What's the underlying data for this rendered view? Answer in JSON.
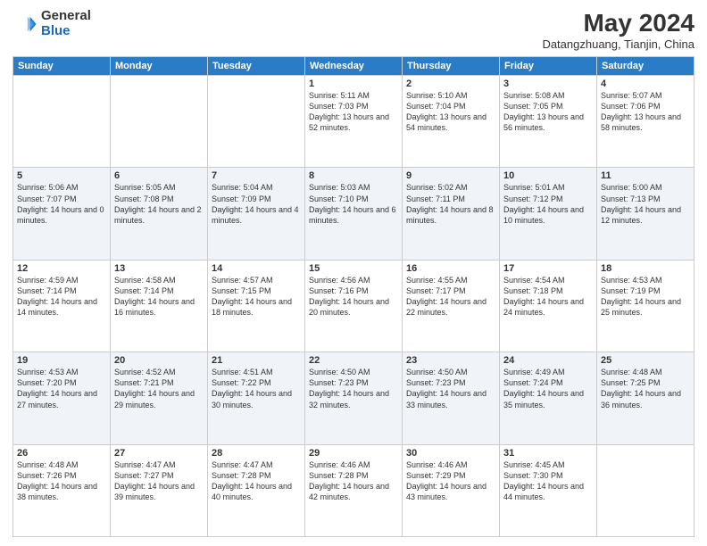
{
  "header": {
    "logo_general": "General",
    "logo_blue": "Blue",
    "month_year": "May 2024",
    "location": "Datangzhuang, Tianjin, China"
  },
  "days_of_week": [
    "Sunday",
    "Monday",
    "Tuesday",
    "Wednesday",
    "Thursday",
    "Friday",
    "Saturday"
  ],
  "weeks": [
    [
      {
        "day": null
      },
      {
        "day": null
      },
      {
        "day": null
      },
      {
        "day": "1",
        "sunrise": "5:11 AM",
        "sunset": "7:03 PM",
        "daylight": "13 hours and 52 minutes."
      },
      {
        "day": "2",
        "sunrise": "5:10 AM",
        "sunset": "7:04 PM",
        "daylight": "13 hours and 54 minutes."
      },
      {
        "day": "3",
        "sunrise": "5:08 AM",
        "sunset": "7:05 PM",
        "daylight": "13 hours and 56 minutes."
      },
      {
        "day": "4",
        "sunrise": "5:07 AM",
        "sunset": "7:06 PM",
        "daylight": "13 hours and 58 minutes."
      }
    ],
    [
      {
        "day": "5",
        "sunrise": "5:06 AM",
        "sunset": "7:07 PM",
        "daylight": "14 hours and 0 minutes."
      },
      {
        "day": "6",
        "sunrise": "5:05 AM",
        "sunset": "7:08 PM",
        "daylight": "14 hours and 2 minutes."
      },
      {
        "day": "7",
        "sunrise": "5:04 AM",
        "sunset": "7:09 PM",
        "daylight": "14 hours and 4 minutes."
      },
      {
        "day": "8",
        "sunrise": "5:03 AM",
        "sunset": "7:10 PM",
        "daylight": "14 hours and 6 minutes."
      },
      {
        "day": "9",
        "sunrise": "5:02 AM",
        "sunset": "7:11 PM",
        "daylight": "14 hours and 8 minutes."
      },
      {
        "day": "10",
        "sunrise": "5:01 AM",
        "sunset": "7:12 PM",
        "daylight": "14 hours and 10 minutes."
      },
      {
        "day": "11",
        "sunrise": "5:00 AM",
        "sunset": "7:13 PM",
        "daylight": "14 hours and 12 minutes."
      }
    ],
    [
      {
        "day": "12",
        "sunrise": "4:59 AM",
        "sunset": "7:14 PM",
        "daylight": "14 hours and 14 minutes."
      },
      {
        "day": "13",
        "sunrise": "4:58 AM",
        "sunset": "7:14 PM",
        "daylight": "14 hours and 16 minutes."
      },
      {
        "day": "14",
        "sunrise": "4:57 AM",
        "sunset": "7:15 PM",
        "daylight": "14 hours and 18 minutes."
      },
      {
        "day": "15",
        "sunrise": "4:56 AM",
        "sunset": "7:16 PM",
        "daylight": "14 hours and 20 minutes."
      },
      {
        "day": "16",
        "sunrise": "4:55 AM",
        "sunset": "7:17 PM",
        "daylight": "14 hours and 22 minutes."
      },
      {
        "day": "17",
        "sunrise": "4:54 AM",
        "sunset": "7:18 PM",
        "daylight": "14 hours and 24 minutes."
      },
      {
        "day": "18",
        "sunrise": "4:53 AM",
        "sunset": "7:19 PM",
        "daylight": "14 hours and 25 minutes."
      }
    ],
    [
      {
        "day": "19",
        "sunrise": "4:53 AM",
        "sunset": "7:20 PM",
        "daylight": "14 hours and 27 minutes."
      },
      {
        "day": "20",
        "sunrise": "4:52 AM",
        "sunset": "7:21 PM",
        "daylight": "14 hours and 29 minutes."
      },
      {
        "day": "21",
        "sunrise": "4:51 AM",
        "sunset": "7:22 PM",
        "daylight": "14 hours and 30 minutes."
      },
      {
        "day": "22",
        "sunrise": "4:50 AM",
        "sunset": "7:23 PM",
        "daylight": "14 hours and 32 minutes."
      },
      {
        "day": "23",
        "sunrise": "4:50 AM",
        "sunset": "7:23 PM",
        "daylight": "14 hours and 33 minutes."
      },
      {
        "day": "24",
        "sunrise": "4:49 AM",
        "sunset": "7:24 PM",
        "daylight": "14 hours and 35 minutes."
      },
      {
        "day": "25",
        "sunrise": "4:48 AM",
        "sunset": "7:25 PM",
        "daylight": "14 hours and 36 minutes."
      }
    ],
    [
      {
        "day": "26",
        "sunrise": "4:48 AM",
        "sunset": "7:26 PM",
        "daylight": "14 hours and 38 minutes."
      },
      {
        "day": "27",
        "sunrise": "4:47 AM",
        "sunset": "7:27 PM",
        "daylight": "14 hours and 39 minutes."
      },
      {
        "day": "28",
        "sunrise": "4:47 AM",
        "sunset": "7:28 PM",
        "daylight": "14 hours and 40 minutes."
      },
      {
        "day": "29",
        "sunrise": "4:46 AM",
        "sunset": "7:28 PM",
        "daylight": "14 hours and 42 minutes."
      },
      {
        "day": "30",
        "sunrise": "4:46 AM",
        "sunset": "7:29 PM",
        "daylight": "14 hours and 43 minutes."
      },
      {
        "day": "31",
        "sunrise": "4:45 AM",
        "sunset": "7:30 PM",
        "daylight": "14 hours and 44 minutes."
      },
      {
        "day": null
      }
    ]
  ]
}
